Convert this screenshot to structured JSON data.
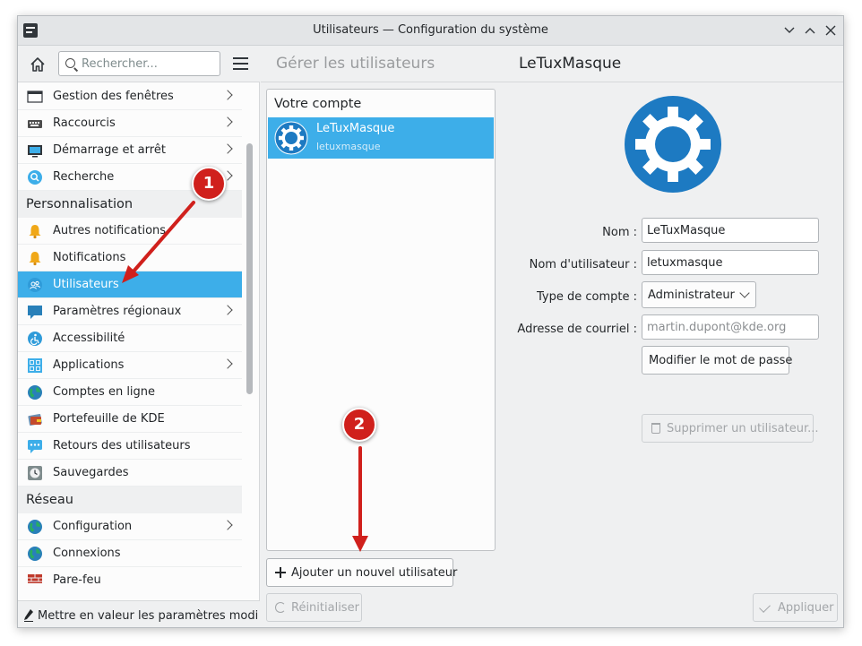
{
  "window": {
    "title": "Utilisateurs — Configuration du système",
    "controls": [
      "minimize",
      "maximize",
      "close"
    ]
  },
  "sidebar": {
    "search_placeholder": "Rechercher...",
    "items": [
      {
        "label": "Gestion des fenêtres",
        "icon": "window-management-icon",
        "has_children": true
      },
      {
        "label": "Raccourcis",
        "icon": "keyboard-icon",
        "has_children": true
      },
      {
        "label": "Démarrage et arrêt",
        "icon": "startup-icon",
        "has_children": true
      },
      {
        "label": "Recherche",
        "icon": "search-icon",
        "has_children": true
      }
    ],
    "category_personnalisation": "Personnalisation",
    "personnalisation_items": [
      {
        "label": "Autres notifications",
        "icon": "bell-icon",
        "has_children": false
      },
      {
        "label": "Notifications",
        "icon": "bell-icon",
        "has_children": false
      },
      {
        "label": "Utilisateurs",
        "icon": "users-icon",
        "has_children": false,
        "selected": true
      },
      {
        "label": "Paramètres régionaux",
        "icon": "flag-icon",
        "has_children": true
      },
      {
        "label": "Accessibilité",
        "icon": "accessibility-icon",
        "has_children": false
      },
      {
        "label": "Applications",
        "icon": "applications-icon",
        "has_children": true
      },
      {
        "label": "Comptes en ligne",
        "icon": "globe-icon",
        "has_children": false
      },
      {
        "label": "Portefeuille de KDE",
        "icon": "wallet-icon",
        "has_children": false
      },
      {
        "label": "Retours des utilisateurs",
        "icon": "feedback-icon",
        "has_children": false
      },
      {
        "label": "Sauvegardes",
        "icon": "backup-icon",
        "has_children": false
      }
    ],
    "category_reseau": "Réseau",
    "reseau_items": [
      {
        "label": "Configuration",
        "icon": "globe-icon",
        "has_children": true
      },
      {
        "label": "Connexions",
        "icon": "globe-icon",
        "has_children": false
      },
      {
        "label": "Pare-feu",
        "icon": "firewall-icon",
        "has_children": false
      }
    ],
    "footer_label": "Mettre en valeur les paramètres modifiés"
  },
  "main": {
    "section_title": "Gérer les utilisateurs",
    "user_title": "LeTuxMasque",
    "list_header": "Votre compte",
    "users": [
      {
        "name": "LeTuxMasque",
        "login": "letuxmasque"
      }
    ],
    "add_user_label": "Ajouter un nouvel utilisateur",
    "form": {
      "name_label": "Nom :",
      "name_value": "LeTuxMasque",
      "username_label": "Nom d'utilisateur :",
      "username_value": "letuxmasque",
      "account_type_label": "Type de compte :",
      "account_type_value": "Administrateur",
      "email_label": "Adresse de courriel :",
      "email_placeholder": "martin.dupont@kde.org",
      "change_password_label": "Modifier le mot de passe",
      "delete_user_label": "Supprimer un utilisateur..."
    },
    "reset_label": "Réinitialiser",
    "apply_label": "Appliquer"
  },
  "annotations": {
    "marker_1": "1",
    "marker_2": "2"
  },
  "colors": {
    "accent": "#3daee9",
    "kde_blue": "#1d7ac2",
    "annotation_red": "#d0201c",
    "window_bg": "#eff0f1"
  }
}
